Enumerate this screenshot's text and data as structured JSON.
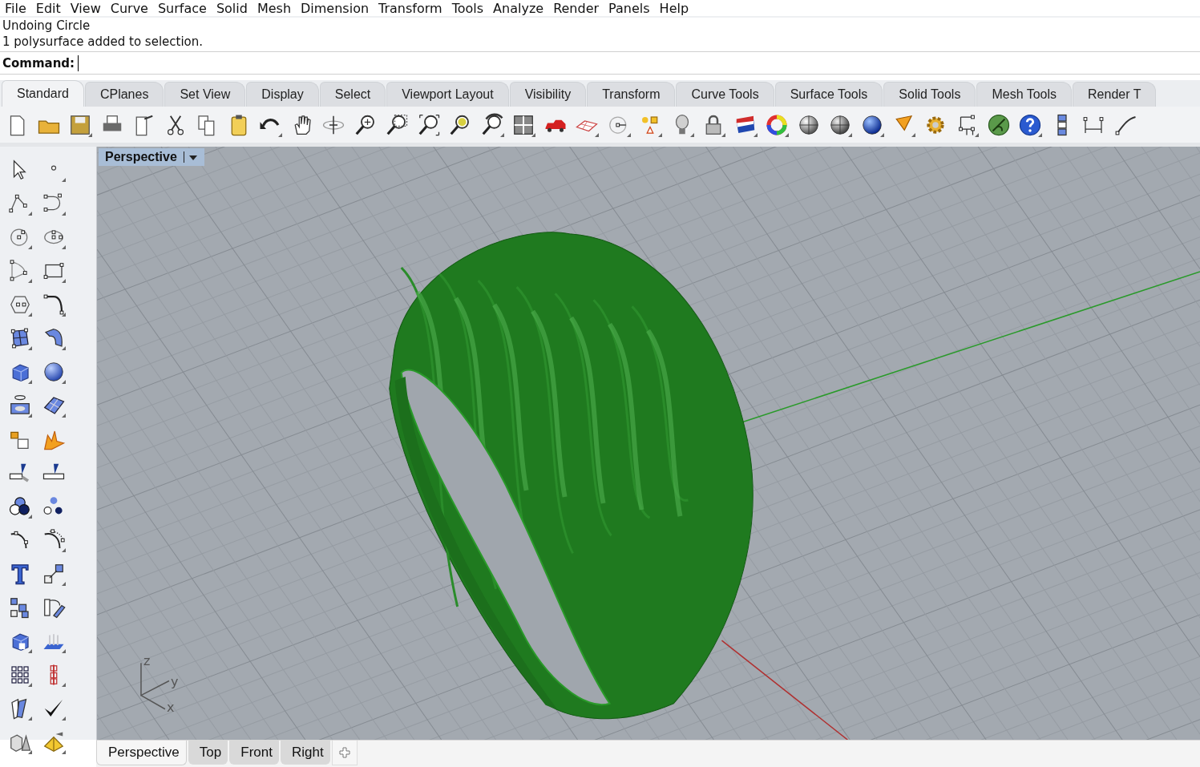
{
  "menu": [
    "File",
    "Edit",
    "View",
    "Curve",
    "Surface",
    "Solid",
    "Mesh",
    "Dimension",
    "Transform",
    "Tools",
    "Analyze",
    "Render",
    "Panels",
    "Help"
  ],
  "command_history": [
    "Undoing Circle",
    "1 polysurface added to selection."
  ],
  "command": {
    "label": "Command:"
  },
  "toolbar_tabs": [
    {
      "label": "Standard",
      "selected": true
    },
    {
      "label": "CPlanes",
      "selected": false
    },
    {
      "label": "Set View",
      "selected": false
    },
    {
      "label": "Display",
      "selected": false
    },
    {
      "label": "Select",
      "selected": false
    },
    {
      "label": "Viewport Layout",
      "selected": false
    },
    {
      "label": "Visibility",
      "selected": false
    },
    {
      "label": "Transform",
      "selected": false
    },
    {
      "label": "Curve Tools",
      "selected": false
    },
    {
      "label": "Surface Tools",
      "selected": false
    },
    {
      "label": "Solid Tools",
      "selected": false
    },
    {
      "label": "Mesh Tools",
      "selected": false
    },
    {
      "label": "Render T",
      "selected": false
    }
  ],
  "viewport": {
    "title": "Perspective",
    "axis_labels": [
      "z",
      "y",
      "x"
    ]
  },
  "viewport_tabs": [
    {
      "label": "Perspective",
      "selected": true
    },
    {
      "label": "Top",
      "selected": false
    },
    {
      "label": "Front",
      "selected": false
    },
    {
      "label": "Right",
      "selected": false
    }
  ]
}
